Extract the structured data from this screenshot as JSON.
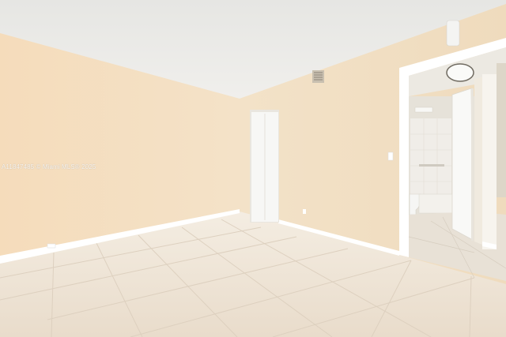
{
  "watermark": {
    "text": "A11847485 © Miami MLS® 2025"
  },
  "colors": {
    "ceiling": "#ededea",
    "left_wall": "#f6e2c6",
    "back_wall": "#f3e3c9",
    "right_wall": "#f1dfc3",
    "floor": "#ede4d8",
    "baseboard": "#ffffff",
    "door": "#f7f7f5"
  }
}
